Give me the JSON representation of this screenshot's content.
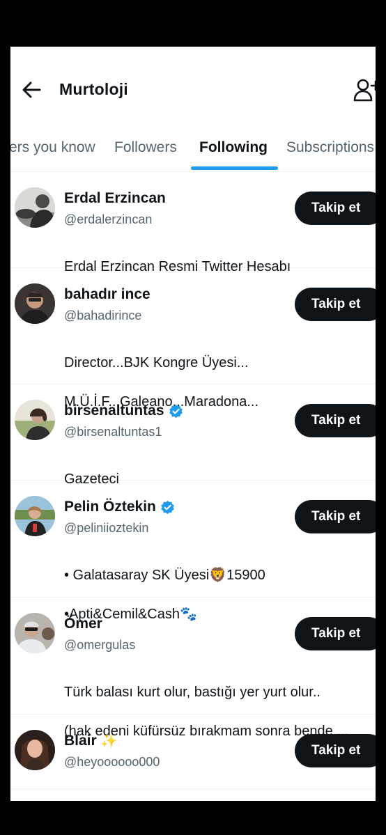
{
  "header": {
    "title": "Murtoloji",
    "back_icon": "arrow-left-icon",
    "add_user_icon": "add-user-icon"
  },
  "tabs": [
    {
      "label": "ers you know",
      "active": false
    },
    {
      "label": "Followers",
      "active": false
    },
    {
      "label": "Following",
      "active": true
    },
    {
      "label": "Subscriptions",
      "active": false
    }
  ],
  "colors": {
    "accent": "#1d9bf0",
    "button_bg": "#0f1419",
    "secondary_text": "#536471"
  },
  "users": [
    {
      "name": "Erdal Erzincan",
      "verified": false,
      "handle": "@erdalerzincan",
      "bio": [
        "Erdal Erzincan Resmi Twitter Hesabı"
      ],
      "button": "Takip et"
    },
    {
      "name": "bahadır ince",
      "verified": false,
      "handle": "@bahadirince",
      "bio": [
        "Director...BJK Kongre Üyesi...",
        "M.Ü.İ.F...Galeano...Maradona..."
      ],
      "button": "Takip et"
    },
    {
      "name": "birsenaltuntas",
      "verified": true,
      "handle": "@birsenaltuntas1",
      "bio": [
        "Gazeteci"
      ],
      "button": "Takip et"
    },
    {
      "name": "Pelin Öztekin",
      "verified": true,
      "handle": "@peliniioztekin",
      "bio": [
        "• Galatasaray SK Üyesi🦁15900",
        "•Apti&Cemil&Cash🐾"
      ],
      "button": "Takip et"
    },
    {
      "name": "Ömer",
      "verified": false,
      "handle": "@omergulas",
      "bio": [
        "Türk balası kurt olur, bastığı yer yurt olur..",
        "(hak edeni küfürsüz bırakmam sonra bende ..."
      ],
      "button": "Takip et"
    },
    {
      "name": "Blair",
      "verified": false,
      "emoji": "✨",
      "handle": "@heyoooooo000",
      "bio": [],
      "button": "Takip et"
    }
  ]
}
